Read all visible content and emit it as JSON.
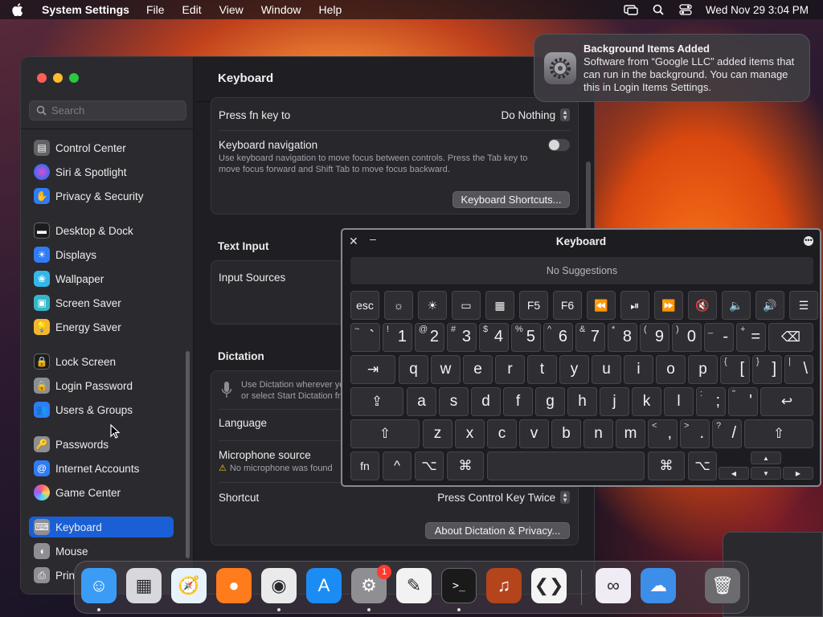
{
  "menubar": {
    "app_name": "System Settings",
    "menus": [
      "File",
      "Edit",
      "View",
      "Window",
      "Help"
    ],
    "datetime": "Wed Nov 29  3:04 PM"
  },
  "sidebar": {
    "search_placeholder": "Search",
    "items": [
      {
        "label": "Control Center",
        "icon": "control-center-icon",
        "color": "#636366"
      },
      {
        "label": "Siri & Spotlight",
        "icon": "siri-icon",
        "color": "#7b3fe4"
      },
      {
        "label": "Privacy & Security",
        "icon": "hand-icon",
        "color": "#2f7cf6"
      },
      {
        "label": "Desktop & Dock",
        "icon": "dock-icon",
        "color": "#3a3a3c"
      },
      {
        "label": "Displays",
        "icon": "sun-icon",
        "color": "#2f7cf6"
      },
      {
        "label": "Wallpaper",
        "icon": "flower-icon",
        "color": "#35b6e8"
      },
      {
        "label": "Screen Saver",
        "icon": "screen-saver-icon",
        "color": "#35b6c8"
      },
      {
        "label": "Energy Saver",
        "icon": "bulb-icon",
        "color": "#f5b62b"
      },
      {
        "label": "Lock Screen",
        "icon": "lock-icon",
        "color": "#3a3a3c"
      },
      {
        "label": "Login Password",
        "icon": "lock-password-icon",
        "color": "#8e8e93"
      },
      {
        "label": "Users & Groups",
        "icon": "users-icon",
        "color": "#2f7cf6"
      },
      {
        "label": "Passwords",
        "icon": "key-icon",
        "color": "#8e8e93"
      },
      {
        "label": "Internet Accounts",
        "icon": "at-icon",
        "color": "#2f7cf6"
      },
      {
        "label": "Game Center",
        "icon": "game-center-icon",
        "color": "#e8e8e8"
      },
      {
        "label": "Keyboard",
        "icon": "keyboard-icon",
        "color": "#8e8e93"
      },
      {
        "label": "Mouse",
        "icon": "mouse-icon",
        "color": "#8e8e93"
      },
      {
        "label": "Prin",
        "icon": "printer-icon",
        "color": "#8e8e93"
      }
    ],
    "active": "Keyboard"
  },
  "main": {
    "title": "Keyboard",
    "press_fn": {
      "label": "Press fn key to",
      "value": "Do Nothing"
    },
    "keyboard_navigation": {
      "label": "Keyboard navigation",
      "description": "Use keyboard navigation to move focus between controls. Press the Tab key to move focus forward and Shift Tab to move focus backward.",
      "enabled": false
    },
    "shortcuts_button": "Keyboard Shortcuts...",
    "text_input": {
      "section": "Text Input",
      "input_sources_label": "Input Sources"
    },
    "dictation": {
      "section": "Dictation",
      "description": "Use Dictation wherever you\nor select Start Dictation fr",
      "language_label": "Language",
      "mic_label": "Microphone source",
      "mic_warning": "No microphone was found",
      "shortcut_label": "Shortcut",
      "shortcut_value": "Press Control Key Twice",
      "about_button": "About Dictation & Privacy..."
    }
  },
  "notification": {
    "title": "Background Items Added",
    "body": "Software from “Google LLC” added items that can run in the background. You can manage this in Login Items Settings.",
    "icon": "gear-icon"
  },
  "keyboard_viewer": {
    "title": "Keyboard",
    "suggestions": "No Suggestions",
    "fn_row": [
      "esc",
      "☼",
      "☀",
      "▭",
      "▦",
      "F5",
      "F6",
      "⏪",
      "⏯",
      "⏩",
      "🔇",
      "🔈",
      "🔊",
      "☰"
    ],
    "number_row": [
      [
        "~",
        "`"
      ],
      [
        "!",
        "1"
      ],
      [
        "@",
        "2"
      ],
      [
        "#",
        "3"
      ],
      [
        "$",
        "4"
      ],
      [
        "%",
        "5"
      ],
      [
        "^",
        "6"
      ],
      [
        "&",
        "7"
      ],
      [
        "*",
        "8"
      ],
      [
        "(",
        "9"
      ],
      [
        ")",
        "0"
      ],
      [
        "_",
        "-"
      ],
      [
        "+",
        "="
      ]
    ],
    "qwerty_row": [
      "q",
      "w",
      "e",
      "r",
      "t",
      "y",
      "u",
      "i",
      "o",
      "p"
    ],
    "qwerty_extra": [
      [
        "{",
        "["
      ],
      [
        "}",
        "]"
      ],
      [
        "|",
        "\\"
      ]
    ],
    "home_row": [
      "a",
      "s",
      "d",
      "f",
      "g",
      "h",
      "j",
      "k",
      "l"
    ],
    "home_extra": [
      [
        ":",
        ";"
      ],
      [
        "\"",
        "'"
      ]
    ],
    "bottom_row": [
      "z",
      "x",
      "c",
      "v",
      "b",
      "n",
      "m"
    ],
    "bottom_extra": [
      [
        "<",
        ","
      ],
      [
        ">",
        "."
      ],
      [
        "?",
        "/"
      ]
    ],
    "mod_keys": {
      "fn": "fn",
      "ctrl": "^",
      "opt": "⌥",
      "cmd": "⌘",
      "shift": "⇧",
      "tab": "⇥",
      "return": "↩",
      "delete": "⌫",
      "caps": "⇪"
    },
    "arrows": {
      "up": "▲",
      "left": "◀",
      "down": "▼",
      "right": "▶"
    }
  },
  "dock": {
    "apps": [
      {
        "name": "Finder",
        "icon": "finder-icon",
        "color": "#3b9cf5",
        "glyph": "☺"
      },
      {
        "name": "Launchpad",
        "icon": "launchpad-icon",
        "color": "#d8d8dc",
        "glyph": "▦"
      },
      {
        "name": "Safari",
        "icon": "safari-icon",
        "color": "#e8f2fb",
        "glyph": "🧭"
      },
      {
        "name": "Firefox",
        "icon": "firefox-icon",
        "color": "#ff7b1c",
        "glyph": "●"
      },
      {
        "name": "Chrome",
        "icon": "chrome-icon",
        "color": "#eaeaea",
        "glyph": "◉"
      },
      {
        "name": "App Store",
        "icon": "app-store-icon",
        "color": "#1c8cf5",
        "glyph": "A"
      },
      {
        "name": "System Settings",
        "icon": "system-settings-icon",
        "color": "#8e8e93",
        "glyph": "⚙"
      },
      {
        "name": "TextEdit",
        "icon": "textedit-icon",
        "color": "#f2f2f2",
        "glyph": "✎"
      },
      {
        "name": "Terminal",
        "icon": "terminal-icon",
        "color": "#1a1a1a",
        "glyph": ">_"
      },
      {
        "name": "GarageBand",
        "icon": "garageband-icon",
        "color": "#b3441c",
        "glyph": "♫"
      },
      {
        "name": "VS Code",
        "icon": "vscode-icon",
        "color": "#f4f4f4",
        "glyph": "❮❯"
      },
      {
        "name": "Visual Studio",
        "icon": "visual-studio-icon",
        "color": "#f0ecf6",
        "glyph": "∞"
      },
      {
        "name": "Weather",
        "icon": "weather-icon",
        "color": "#3c8ee8",
        "glyph": "☁"
      },
      {
        "name": "Trash",
        "icon": "trash-icon",
        "color": "#6c6c70",
        "glyph": "🗑"
      }
    ],
    "settings_badge": "1"
  }
}
